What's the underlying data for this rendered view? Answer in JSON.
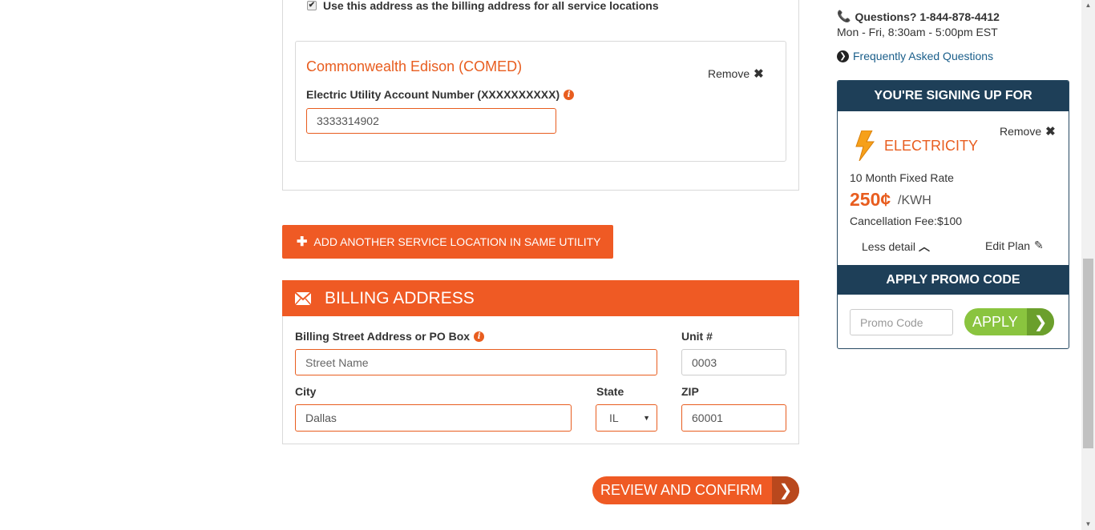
{
  "service": {
    "billing_checkbox_label": "Use this address as the billing address for all service locations",
    "billing_checkbox_checked": true,
    "utility_name": "Commonwealth Edison (COMED)",
    "remove_label": "Remove",
    "account_label": "Electric Utility Account Number (XXXXXXXXXX)",
    "account_value": "3333314902"
  },
  "add_location_label": "ADD ANOTHER SERVICE LOCATION IN SAME UTILITY",
  "billing": {
    "title": "BILLING ADDRESS",
    "street_label": "Billing Street Address or PO Box",
    "street_placeholder": "Street Name",
    "unit_label": "Unit #",
    "unit_value": "0003",
    "city_label": "City",
    "city_value": "Dallas",
    "state_label": "State",
    "state_value": "IL",
    "zip_label": "ZIP",
    "zip_value": "60001"
  },
  "review_button_label": "REVIEW AND CONFIRM",
  "sidebar": {
    "phone_text": "Questions? 1-844-878-4412",
    "hours_text": "Mon - Fri, 8:30am - 5:00pm EST",
    "faq_label": "Frequently Asked Questions",
    "signup_header": "YOU'RE SIGNING UP FOR",
    "remove_label": "Remove",
    "product_name": "ELECTRICITY",
    "plan_name": "10 Month Fixed Rate",
    "price": "250¢",
    "price_unit": "/KWH",
    "cancellation": "Cancellation Fee:$100",
    "less_detail": "Less detail",
    "edit_plan": "Edit Plan",
    "promo_header": "APPLY PROMO CODE",
    "promo_placeholder": "Promo Code",
    "apply_label": "APPLY"
  },
  "colors": {
    "accent": "#ef5a24",
    "dark_header": "#1e3f58",
    "apply_green": "#8ac43f",
    "link_blue": "#1a5e8a"
  }
}
